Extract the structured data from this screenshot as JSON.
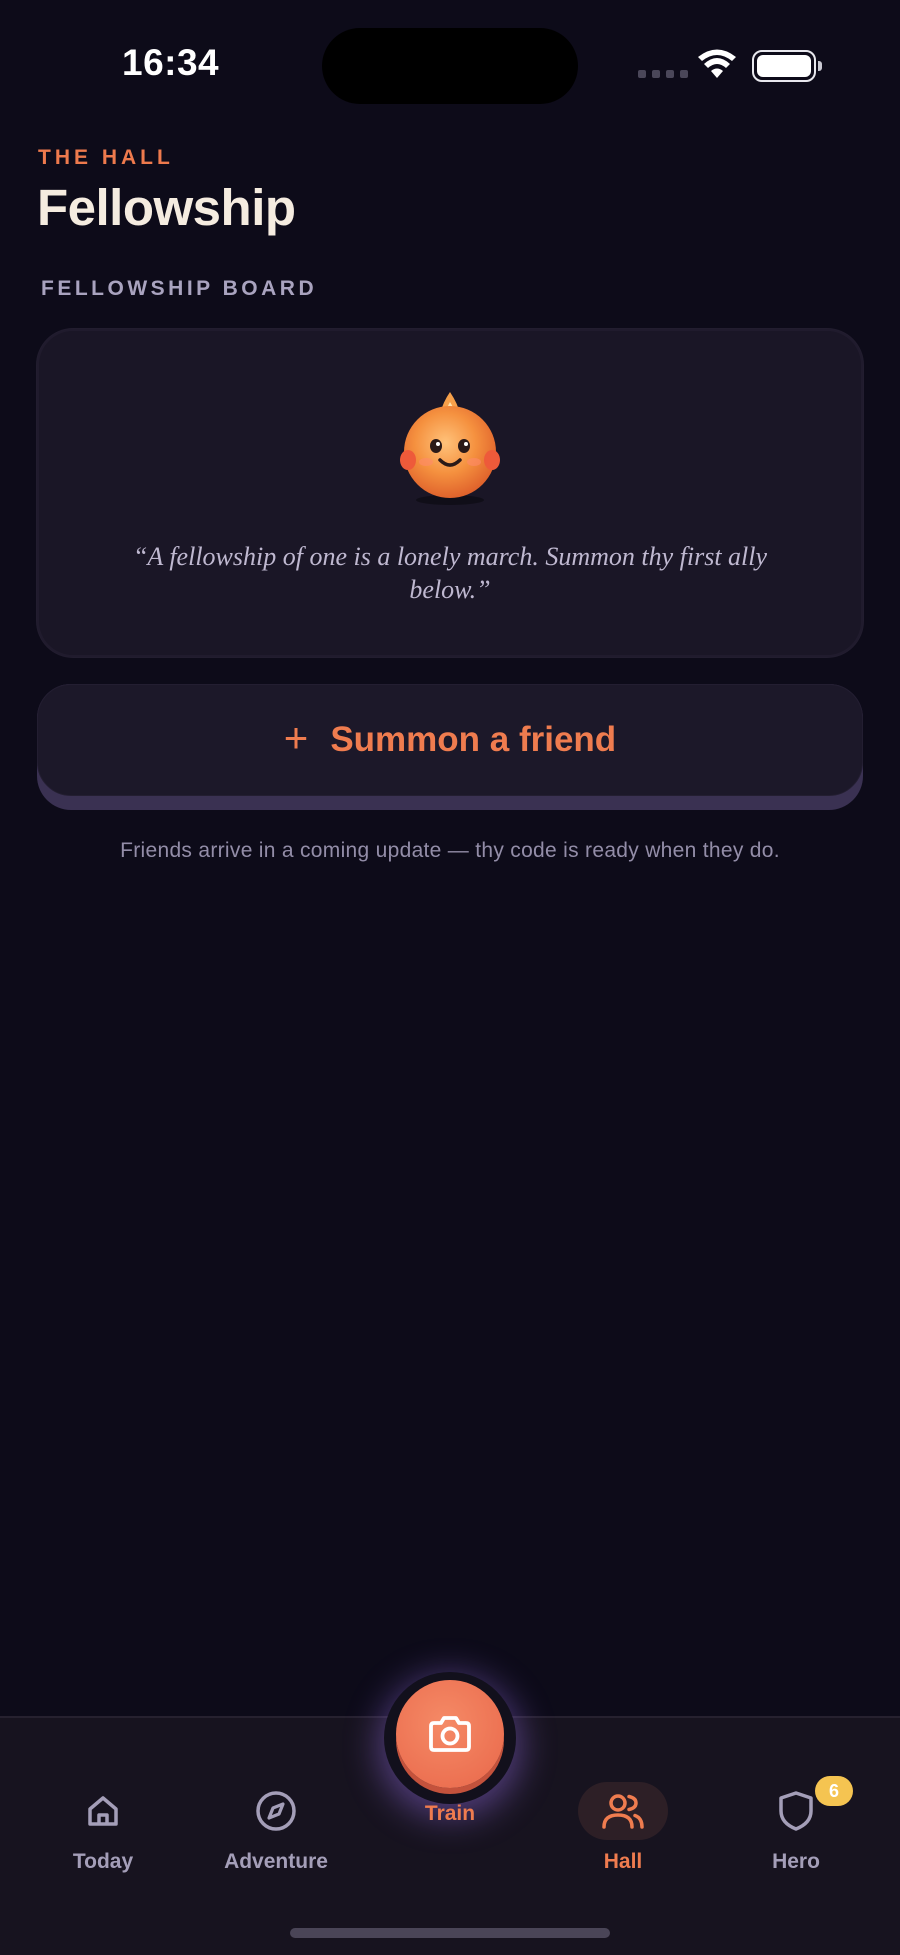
{
  "status_bar": {
    "time": "16:34"
  },
  "header": {
    "eyebrow": "THE HALL",
    "title": "Fellowship"
  },
  "board": {
    "section_label": "FELLOWSHIP BOARD",
    "quote": "“A fellowship of one is a lonely march. Summon thy first ally below.”"
  },
  "summon": {
    "icon": "plus-icon",
    "label": "Summon a friend",
    "note": "Friends arrive in a coming update — thy code is ready when they do."
  },
  "tabbar": {
    "today": {
      "label": "Today",
      "icon": "home-icon"
    },
    "adventure": {
      "label": "Adventure",
      "icon": "compass-icon"
    },
    "train": {
      "label": "Train",
      "icon": "camera-icon"
    },
    "hall": {
      "label": "Hall",
      "icon": "users-icon",
      "active": true
    },
    "hero": {
      "label": "Hero",
      "icon": "shield-icon",
      "badge": "6"
    }
  },
  "colors": {
    "background": "#0d0b19",
    "accent": "#ef7c4f",
    "card": "#1a1626",
    "badge": "#f5c451"
  }
}
